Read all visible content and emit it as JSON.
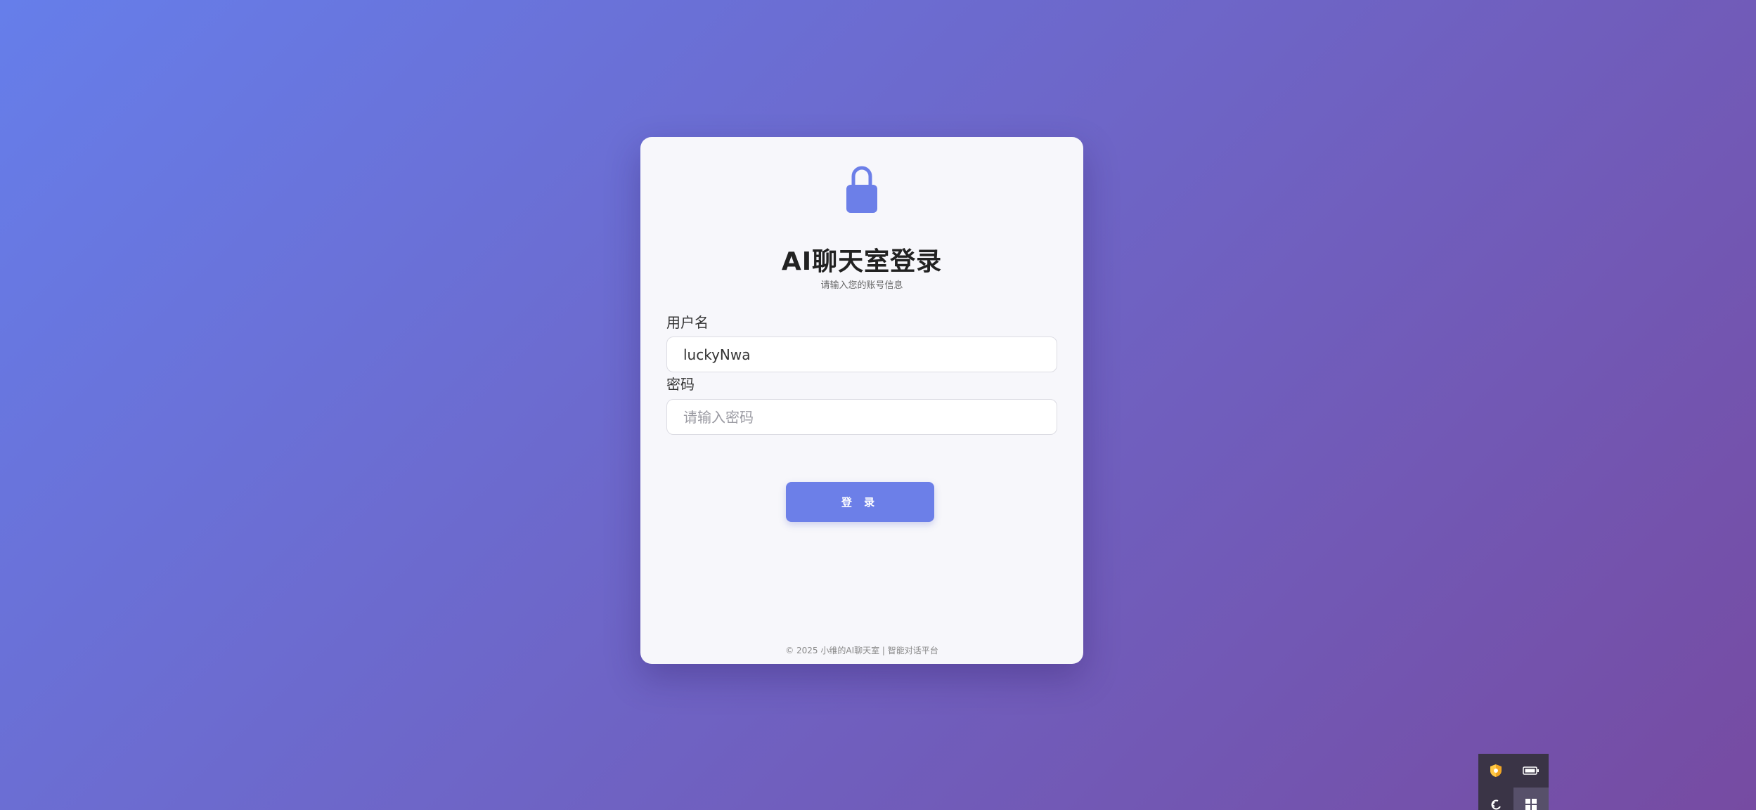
{
  "login": {
    "title": "AI聊天室登录",
    "subtitle": "请输入您的账号信息",
    "username_label": "用户名",
    "username_value": "luckyNwa",
    "password_label": "密码",
    "password_placeholder": "请输入密码",
    "login_button": "登 录",
    "footer": "© 2025 小维的AI聊天室 | 智能对话平台"
  },
  "icons": {
    "lock": "lock-icon",
    "tray": [
      "shield-icon",
      "battery-icon",
      "back-arrow-icon",
      "windows-grid-icon"
    ]
  },
  "colors": {
    "background_start": "#667eea",
    "background_end": "#764ba2",
    "accent": "#6c7fe8",
    "card": "#f7f7fb"
  }
}
